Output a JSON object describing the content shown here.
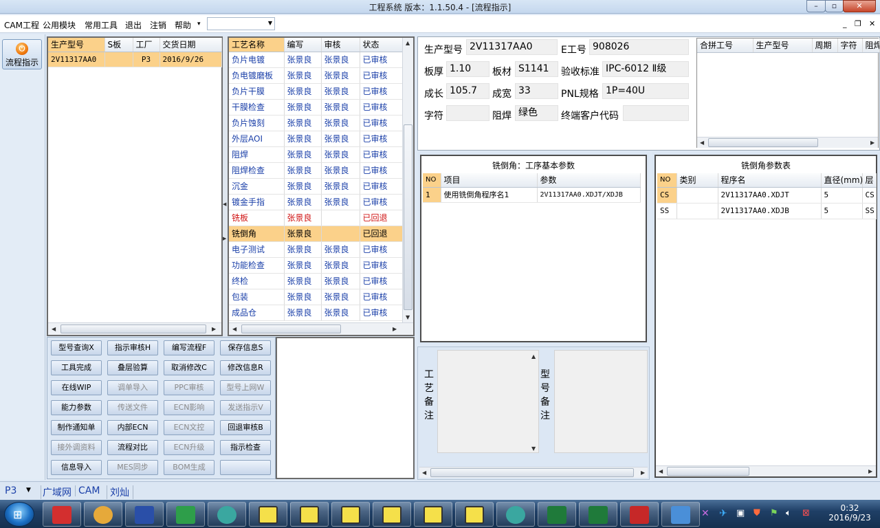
{
  "window": {
    "title": "工程系统  版本：1.1.50.4 - [流程指示]",
    "min": "–",
    "max": "▫",
    "close": "✕"
  },
  "menu": {
    "items": [
      "CAM工程",
      "公用模块",
      "常用工具",
      "退出",
      "注销",
      "帮助"
    ],
    "help_arrow": "▾",
    "combo_value": ""
  },
  "mdi_controls": {
    "min": "_",
    "restore": "❐",
    "close": "✕"
  },
  "nav": {
    "button_label": "流程指示",
    "icon_glyph": "⏻"
  },
  "orders": {
    "columns": [
      "生产型号",
      "S板",
      "工厂",
      "交货日期"
    ],
    "rows": [
      {
        "model": "2V11317AA0",
        "s": "",
        "factory": "P3",
        "date": "2016/9/26"
      }
    ]
  },
  "process": {
    "columns": [
      "工艺名称",
      "编写",
      "审核",
      "状态"
    ],
    "rows": [
      {
        "name": "负片电镀",
        "writer": "张景良",
        "reviewer": "张景良",
        "status": "已审核",
        "flag": "normal"
      },
      {
        "name": "负电镀磨板",
        "writer": "张景良",
        "reviewer": "张景良",
        "status": "已审核",
        "flag": "normal"
      },
      {
        "name": "负片干膜",
        "writer": "张景良",
        "reviewer": "张景良",
        "status": "已审核",
        "flag": "normal"
      },
      {
        "name": "干膜检查",
        "writer": "张景良",
        "reviewer": "张景良",
        "status": "已审核",
        "flag": "normal"
      },
      {
        "name": "负片蚀刻",
        "writer": "张景良",
        "reviewer": "张景良",
        "status": "已审核",
        "flag": "normal"
      },
      {
        "name": "外层AOI",
        "writer": "张景良",
        "reviewer": "张景良",
        "status": "已审核",
        "flag": "normal"
      },
      {
        "name": "阻焊",
        "writer": "张景良",
        "reviewer": "张景良",
        "status": "已审核",
        "flag": "normal"
      },
      {
        "name": "阻焊检查",
        "writer": "张景良",
        "reviewer": "张景良",
        "status": "已审核",
        "flag": "normal"
      },
      {
        "name": "沉金",
        "writer": "张景良",
        "reviewer": "张景良",
        "status": "已审核",
        "flag": "normal"
      },
      {
        "name": "镀金手指",
        "writer": "张景良",
        "reviewer": "张景良",
        "status": "已审核",
        "flag": "normal"
      },
      {
        "name": "铣板",
        "writer": "张景良",
        "reviewer": "",
        "status": "已回退",
        "flag": "returned"
      },
      {
        "name": "铣倒角",
        "writer": "张景良",
        "reviewer": "",
        "status": "已回退",
        "flag": "selected"
      },
      {
        "name": "电子测试",
        "writer": "张景良",
        "reviewer": "张景良",
        "status": "已审核",
        "flag": "normal"
      },
      {
        "name": "功能检查",
        "writer": "张景良",
        "reviewer": "张景良",
        "status": "已审核",
        "flag": "normal"
      },
      {
        "name": "终检",
        "writer": "张景良",
        "reviewer": "张景良",
        "status": "已审核",
        "flag": "normal"
      },
      {
        "name": "包装",
        "writer": "张景良",
        "reviewer": "张景良",
        "status": "已审核",
        "flag": "normal"
      },
      {
        "name": "成品仓",
        "writer": "张景良",
        "reviewer": "张景良",
        "status": "已审核",
        "flag": "normal"
      }
    ]
  },
  "buttons": [
    {
      "label": "型号查询X",
      "enabled": true
    },
    {
      "label": "指示审核H",
      "enabled": true
    },
    {
      "label": "编写流程F",
      "enabled": true
    },
    {
      "label": "保存信息S",
      "enabled": true
    },
    {
      "label": "工具完成",
      "enabled": true
    },
    {
      "label": "叠层验算",
      "enabled": true
    },
    {
      "label": "取消修改C",
      "enabled": true
    },
    {
      "label": "修改信息R",
      "enabled": true
    },
    {
      "label": "在线WIP",
      "enabled": true
    },
    {
      "label": "调单导入",
      "enabled": false
    },
    {
      "label": "PPC审核",
      "enabled": false
    },
    {
      "label": "型号上网W",
      "enabled": false
    },
    {
      "label": "能力参数",
      "enabled": true
    },
    {
      "label": "传送文件",
      "enabled": false
    },
    {
      "label": "ECN影响",
      "enabled": false
    },
    {
      "label": "发送指示V",
      "enabled": false
    },
    {
      "label": "制作通知单",
      "enabled": true
    },
    {
      "label": "内部ECN",
      "enabled": true
    },
    {
      "label": "ECN文控",
      "enabled": false
    },
    {
      "label": "回退审核B",
      "enabled": true
    },
    {
      "label": "接外调资料",
      "enabled": false
    },
    {
      "label": "流程对比",
      "enabled": true
    },
    {
      "label": "ECN升级",
      "enabled": false
    },
    {
      "label": "指示检查",
      "enabled": true
    },
    {
      "label": "信息导入",
      "enabled": true
    },
    {
      "label": "MES同步",
      "enabled": false
    },
    {
      "label": "BOM生成",
      "enabled": false
    },
    {
      "label": "",
      "enabled": true
    }
  ],
  "info": {
    "model_label": "生产型号",
    "model": "2V11317AA0",
    "e_label": "E工号",
    "e_no": "908026",
    "thick_label": "板厚",
    "thick": "1.10",
    "mat_label": "板材",
    "mat": "S1141",
    "std_label": "验收标准",
    "std": "IPC-6012 Ⅱ级",
    "len_label": "成长",
    "len": "105.7",
    "wid_label": "成宽",
    "wid": "33",
    "pnl_label": "PNL规格",
    "pnl": "1P=40U",
    "char_label": "字符",
    "char": "",
    "mask_label": "阻焊",
    "mask": "绿色",
    "cust_label": "终端客户代码",
    "cust": ""
  },
  "combine": {
    "columns": [
      "合拼工号",
      "生产型号",
      "周期",
      "字符",
      "阻焊"
    ]
  },
  "basic_params": {
    "title": "铣倒角：工序基本参数",
    "columns": [
      "NO",
      "项目",
      "参数"
    ],
    "rows": [
      {
        "no": "1",
        "item": "使用铣倒角程序名1",
        "param": "2V11317AA0.XDJT/XDJB"
      }
    ]
  },
  "param_table": {
    "title": "铣倒角参数表",
    "columns": [
      "NO",
      "类别",
      "程序名",
      "直径(mm)",
      "层"
    ],
    "rows": [
      {
        "no": "CS",
        "cat": "",
        "prog": "2V11317AA0.XDJT",
        "dia": "5",
        "layer": "CS"
      },
      {
        "no": "SS",
        "cat": "",
        "prog": "2V11317AA0.XDJB",
        "dia": "5",
        "layer": "SS"
      }
    ]
  },
  "notes": {
    "process_label": "工艺备注",
    "model_label": "型号备注"
  },
  "status": {
    "factory": "P3",
    "network": "广域网",
    "dept": "CAM",
    "user": "刘灿"
  },
  "tray": {
    "time": "0:32",
    "date": "2016/9/23"
  },
  "colors": {
    "accent_orange": "#fbd18a",
    "link_blue": "#1a3fa8",
    "returned_red": "#d01515"
  }
}
